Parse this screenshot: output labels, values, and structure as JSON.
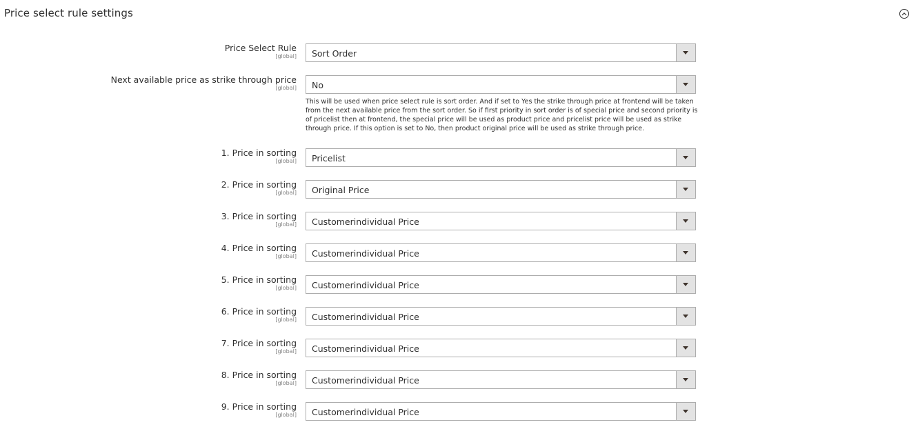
{
  "section": {
    "title": "Price select rule settings",
    "collapse_icon": "chevron-up-circle-icon"
  },
  "fields": [
    {
      "label": "Price Select Rule",
      "scope": "[global]",
      "value": "Sort Order"
    },
    {
      "label": "Next available price as strike through price",
      "scope": "[global]",
      "value": "No",
      "note": "This will be used when price select rule is sort order. And if set to Yes the strike through price at frontend will be taken from the next available price from the sort order. So if first priority in sort order is of special price and second priority is of pricelist then at frontend, the special price will be used as product price and pricelist price will be used as strike through price. If this option is set to No, then product original price will be used as strike through price."
    },
    {
      "label": "1. Price in sorting",
      "scope": "[global]",
      "value": "Pricelist"
    },
    {
      "label": "2. Price in sorting",
      "scope": "[global]",
      "value": "Original Price"
    },
    {
      "label": "3. Price in sorting",
      "scope": "[global]",
      "value": "Customerindividual Price"
    },
    {
      "label": "4. Price in sorting",
      "scope": "[global]",
      "value": "Customerindividual Price"
    },
    {
      "label": "5. Price in sorting",
      "scope": "[global]",
      "value": "Customerindividual Price"
    },
    {
      "label": "6. Price in sorting",
      "scope": "[global]",
      "value": "Customerindividual Price"
    },
    {
      "label": "7. Price in sorting",
      "scope": "[global]",
      "value": "Customerindividual Price"
    },
    {
      "label": "8. Price in sorting",
      "scope": "[global]",
      "value": "Customerindividual Price"
    },
    {
      "label": "9. Price in sorting",
      "scope": "[global]",
      "value": "Customerindividual Price"
    }
  ]
}
